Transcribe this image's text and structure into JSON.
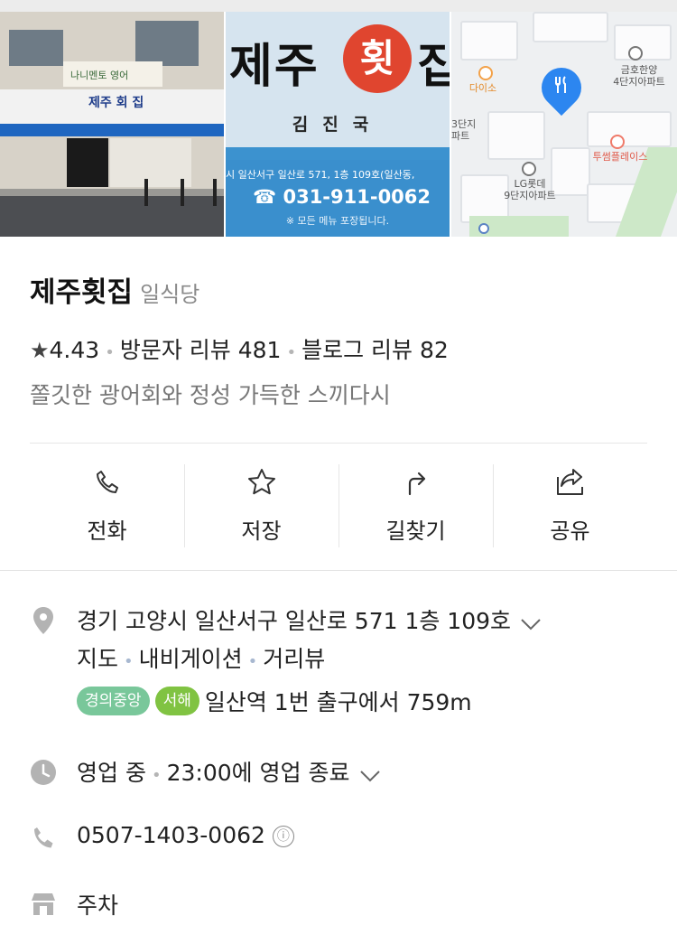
{
  "photos": {
    "storefront": {
      "sign_text": "제주 회 집",
      "academy_sign": "나니멘토 영어"
    },
    "sign": {
      "big_left": "제주",
      "big_circle": "횟",
      "big_right": "집",
      "owner": "김진국",
      "address": "시 일산서구 일산로 571, 1층 109호(일산동,",
      "phone": "☎ 031-911-0062",
      "note": "※ 모든 메뉴 포장됩니다."
    },
    "map": {
      "label_daiso": "다이소",
      "label_kumho": "금호한양\n4단지아파트",
      "label_3danji": "3단지\n파트",
      "label_tosome": "투썸플레이스",
      "label_lg": "LG롯데\n9단지아파트"
    }
  },
  "place": {
    "name": "제주횟집",
    "category": "일식당",
    "rating": "4.43",
    "visitor_reviews": "방문자 리뷰 481",
    "blog_reviews": "블로그 리뷰 82",
    "description": "쫄깃한 광어회와 정성 가득한 스끼다시"
  },
  "actions": {
    "call": "전화",
    "save": "저장",
    "directions": "길찾기",
    "share": "공유"
  },
  "details": {
    "address": "경기 고양시 일산서구 일산로 571 1층 109호",
    "links": {
      "map": "지도",
      "navigation": "내비게이션",
      "street_view": "거리뷰"
    },
    "subway": {
      "line1": "경의중앙",
      "line2": "서해",
      "text": "일산역 1번 출구에서 759m"
    },
    "hours": {
      "status": "영업 중",
      "close_text": "23:00에 영업 종료"
    },
    "phone": "0507-1403-0062",
    "info_icon": "ⓘ",
    "parking": "주차"
  },
  "colors": {
    "link": "#2f6ec6",
    "line_gyeongui": "#79c79a",
    "line_seohae": "#80c342",
    "map_pin": "#2c86f0"
  }
}
